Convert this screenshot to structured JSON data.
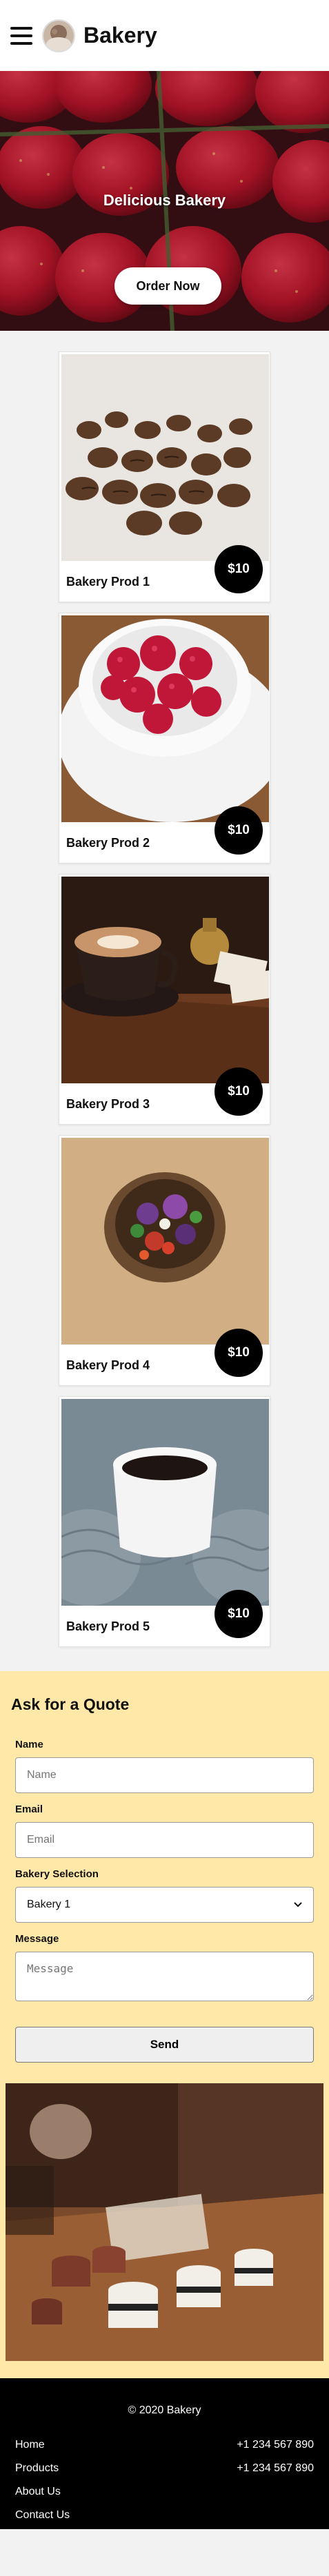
{
  "header": {
    "menu_icon": "hamburger-menu-icon",
    "logo_icon": "bakery-logo-icon",
    "brand": "Bakery"
  },
  "hero": {
    "title": "Delicious Bakery",
    "cta_label": "Order Now"
  },
  "products": [
    {
      "name": "Bakery Prod 1",
      "price": "$10"
    },
    {
      "name": "Bakery Prod 2",
      "price": "$10"
    },
    {
      "name": "Bakery Prod 3",
      "price": "$10"
    },
    {
      "name": "Bakery Prod 4",
      "price": "$10"
    },
    {
      "name": "Bakery Prod 5",
      "price": "$10"
    }
  ],
  "quote": {
    "title": "Ask for a Quote",
    "name_label": "Name",
    "name_placeholder": "Name",
    "email_label": "Email",
    "email_placeholder": "Email",
    "selection_label": "Bakery Selection",
    "selection_value": "Bakery 1",
    "message_label": "Message",
    "message_placeholder": "Message",
    "send_label": "Send"
  },
  "footer": {
    "copyright": "© 2020 Bakery",
    "links": [
      "Home",
      "Products",
      "About Us",
      "Contact Us"
    ],
    "phones": [
      "+1 234 567 890",
      "+1 234 567 890"
    ]
  },
  "colors": {
    "form_background": "#ffe8a8",
    "price_badge": "#000000",
    "footer_background": "#000000"
  }
}
